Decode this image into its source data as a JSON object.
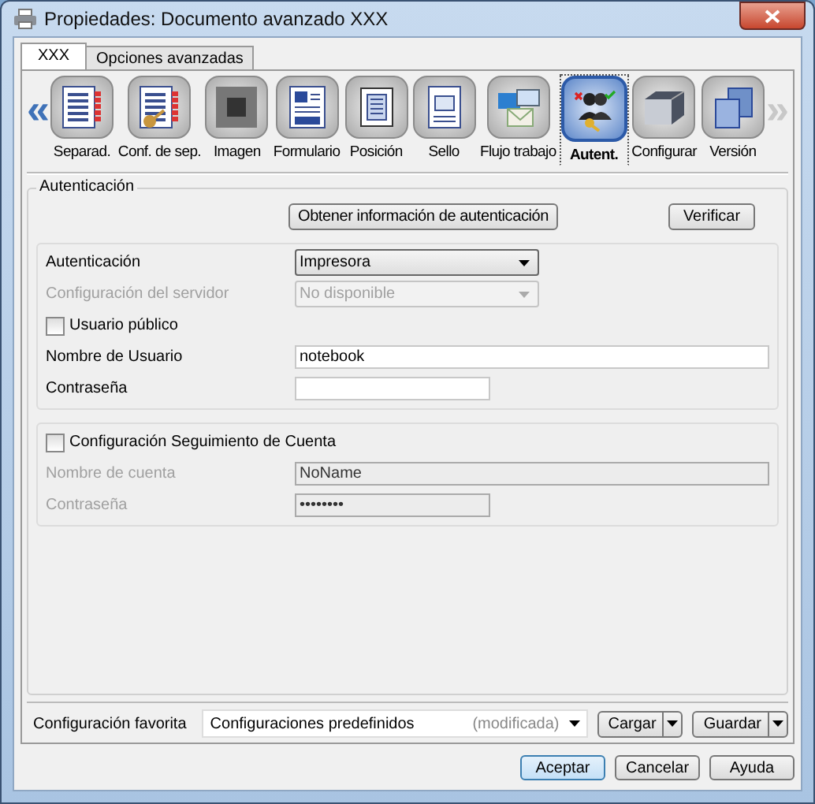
{
  "window": {
    "title": "Propiedades: Documento avanzado XXX"
  },
  "tabs": [
    {
      "label": "XXX",
      "selected": true
    },
    {
      "label": "Opciones avanzadas",
      "selected": false
    }
  ],
  "toolbar": {
    "prev": {
      "label": "«",
      "disabled": false
    },
    "next": {
      "label": "»",
      "disabled": true
    },
    "items": [
      {
        "label": "Separad.",
        "selected": false
      },
      {
        "label": "Conf. de sep.",
        "selected": false
      },
      {
        "label": "Imagen",
        "selected": false
      },
      {
        "label": "Formulario",
        "selected": false
      },
      {
        "label": "Posición",
        "selected": false
      },
      {
        "label": "Sello",
        "selected": false
      },
      {
        "label": "Flujo trabajo",
        "selected": false
      },
      {
        "label": "Autent.",
        "selected": true
      },
      {
        "label": "Configurar",
        "selected": false
      },
      {
        "label": "Versión",
        "selected": false
      }
    ]
  },
  "auth_group": {
    "title": "Autenticación",
    "buttons": [
      {
        "label": "Obtener información de autenticación"
      },
      {
        "label": "Verificar"
      }
    ],
    "fields": [
      {
        "kind": "dropdown",
        "label": "Autenticación",
        "value": "Impresora",
        "disabled": false
      },
      {
        "kind": "dropdown",
        "label": "Configuración del servidor",
        "value": "No disponible",
        "disabled": true
      },
      {
        "kind": "checkbox",
        "label": "Usuario público",
        "checked": false,
        "disabled": false
      },
      {
        "kind": "text",
        "label": "Nombre de Usuario",
        "value": "notebook",
        "disabled": false
      },
      {
        "kind": "short",
        "label": "Contraseña",
        "disabled": false
      }
    ]
  },
  "account_group": {
    "fields": [
      {
        "kind": "checkbox",
        "label": "Configuración Seguimiento de Cuenta",
        "checked": false,
        "disabled": false
      },
      {
        "kind": "text",
        "label": "Nombre de cuenta",
        "value": "NoName",
        "disabled": true
      },
      {
        "kind": "short",
        "label": "Contraseña",
        "value": "••••••••",
        "disabled": true
      }
    ]
  },
  "favorites": {
    "label": "Configuración favorita",
    "value": "Configuraciones predefinidos",
    "note": "(modificada)",
    "buttons": [
      {
        "label": "Cargar"
      },
      {
        "label": "Guardar"
      }
    ]
  },
  "dialog_buttons": [
    {
      "label": "Aceptar",
      "default": true
    },
    {
      "label": "Cancelar",
      "default": false
    },
    {
      "label": "Ayuda",
      "default": false
    }
  ]
}
